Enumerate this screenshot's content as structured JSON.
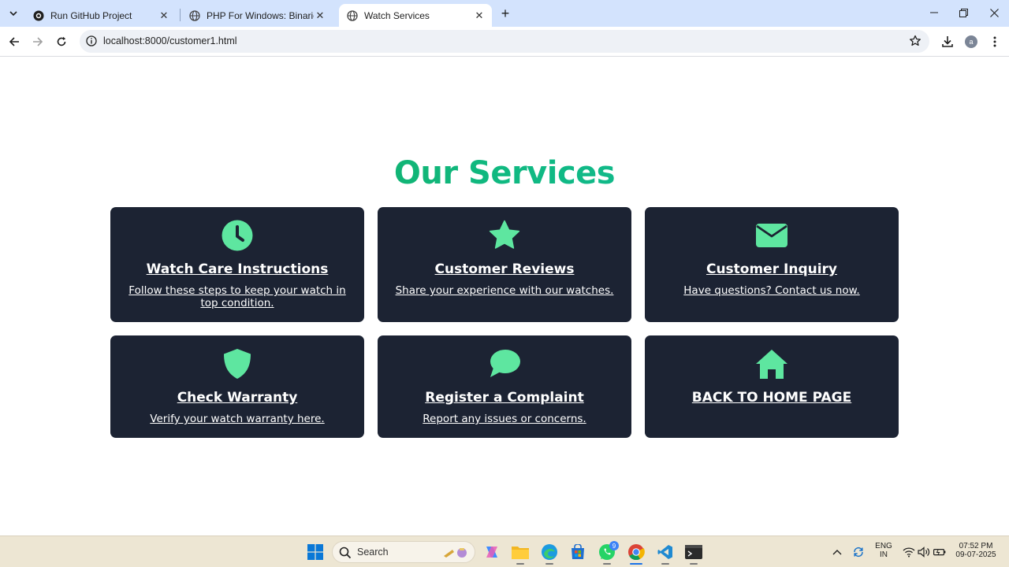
{
  "browser": {
    "tabs": [
      {
        "title": "Run GitHub Project",
        "favicon": "github-icon",
        "active": false
      },
      {
        "title": "PHP For Windows: Binaries and",
        "favicon": "globe-icon",
        "active": false
      },
      {
        "title": "Watch Services",
        "favicon": "globe-icon",
        "active": true
      }
    ],
    "new_tab_label": "+",
    "url": "localhost:8000/customer1.html",
    "profile_initial": "a"
  },
  "page": {
    "title": "Our Services",
    "accent_color": "#5ee6a0",
    "card_color": "#1c2333",
    "cards": [
      {
        "title": "Watch Care Instructions",
        "description": "Follow these steps to keep your watch in top condition.",
        "icon": "clock-icon"
      },
      {
        "title": "Customer Reviews",
        "description": "Share your experience with our watches.",
        "icon": "star-icon"
      },
      {
        "title": "Customer Inquiry",
        "description": "Have questions? Contact us now.",
        "icon": "envelope-icon"
      },
      {
        "title": "Check Warranty",
        "description": "Verify your watch warranty here.",
        "icon": "shield-icon"
      },
      {
        "title": "Register a Complaint",
        "description": "Report any issues or concerns.",
        "icon": "chat-bubble-icon"
      },
      {
        "title": "BACK TO HOME PAGE",
        "description": "",
        "icon": "home-icon"
      }
    ]
  },
  "taskbar": {
    "search_label": "Search",
    "whatsapp_badge": "9",
    "language": "ENG",
    "region": "IN",
    "time": "07:52 PM",
    "date": "09-07-2025"
  }
}
